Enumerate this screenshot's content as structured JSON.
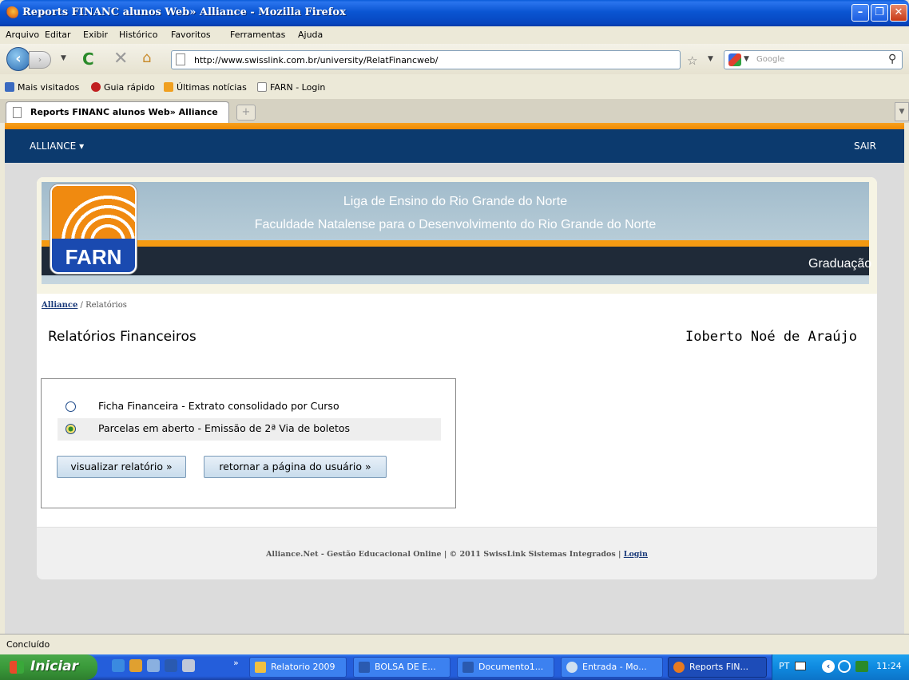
{
  "window": {
    "title": "Reports FINANC alunos Web» Alliance - Mozilla Firefox",
    "min_glyph": "–",
    "max_glyph": "❐",
    "close_glyph": "✕"
  },
  "menu": {
    "items": [
      "Arquivo",
      "Editar",
      "Exibir",
      "Histórico",
      "Favoritos",
      "Ferramentas",
      "Ajuda"
    ]
  },
  "nav": {
    "back_glyph": "‹",
    "fwd_glyph": "›",
    "reload_glyph": "C",
    "stop_glyph": "✕",
    "home_glyph": "⌂",
    "url": "http://www.swisslink.com.br/university/RelatFinancweb/",
    "star_glyph": "☆",
    "search_placeholder": "Google",
    "search_glyph": "⚲"
  },
  "bookmarks": {
    "items": [
      "Mais visitados",
      "Guia rápido",
      "Últimas notícias",
      "FARN - Login"
    ]
  },
  "tabs": {
    "active_label": "Reports FINANC alunos Web» Alliance",
    "newtab_glyph": "+"
  },
  "site": {
    "nav_menu": "ALLIANCE ▾",
    "nav_logout": "SAIR",
    "banner_line1": "Liga de Ensino do Rio Grande do Norte",
    "banner_line2": "Faculdade Natalense para o Desenvolvimento do Rio Grande do Norte",
    "banner_section": "Graduação",
    "logo_text": "FARN",
    "breadcrumb_link": "Alliance",
    "breadcrumb_rest": " / Relatórios",
    "page_title": "Relatórios Financeiros",
    "user_name": "Ioberto Noé de Araújo",
    "options": [
      {
        "label": "Ficha Financeira - Extrato consolidado por Curso",
        "selected": false
      },
      {
        "label": "Parcelas em aberto - Emissão de 2ª Via de boletos",
        "selected": true
      }
    ],
    "btn_view": "visualizar relatório »",
    "btn_return": "retornar a página do usuário »",
    "footer_text": "Alliance.Net - Gestão Educacional Online | © 2011 SwissLink Sistemas Integrados | ",
    "footer_login": "Login"
  },
  "status": {
    "text": "Concluído"
  },
  "taskbar": {
    "start_label": "Iniciar",
    "chevron": "»",
    "tasks": [
      "Relatorio 2009",
      "BOLSA DE E...",
      "Documento1...",
      "Entrada - Mo...",
      "Reports FIN..."
    ],
    "lang": "PT",
    "clock": "11:24"
  },
  "colors": {
    "nav_bg": "#0c3a6e",
    "accent_orange": "#f49a12",
    "banner_dark": "#1f2a38"
  }
}
